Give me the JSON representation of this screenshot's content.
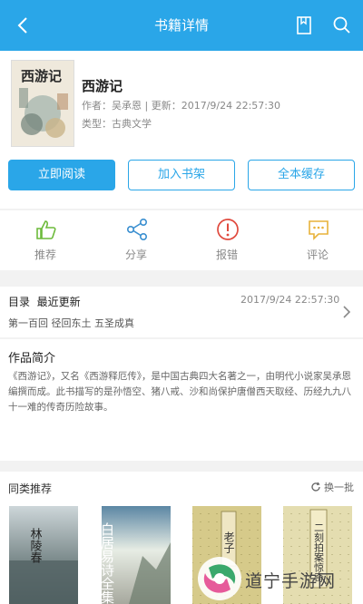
{
  "header": {
    "title": "书籍详情"
  },
  "book": {
    "title": "西游记",
    "author_label": "作者：",
    "author": "吴承恩",
    "update_label": "更新：",
    "update_time": "2017/9/24 22:57:30",
    "type_label": "类型：",
    "type": "古典文学",
    "cover_text": "西游记"
  },
  "buttons": {
    "read": "立即阅读",
    "add_shelf": "加入书架",
    "cache_all": "全本缓存"
  },
  "actions": [
    {
      "label": "推荐",
      "icon": "thumbs-up-icon",
      "color": "#6cba3a"
    },
    {
      "label": "分享",
      "icon": "share-icon",
      "color": "#3a8fd0"
    },
    {
      "label": "报错",
      "icon": "error-icon",
      "color": "#e04a3e"
    },
    {
      "label": "评论",
      "icon": "comment-icon",
      "color": "#e8b23a"
    }
  ],
  "catalog": {
    "label": "目录",
    "latest_label": "最近更新",
    "time": "2017/9/24 22:57:30",
    "latest_chapter": "第一百回 径回东土 五圣成真"
  },
  "intro": {
    "heading": "作品简介",
    "text": "《西游记》，又名《西游释厄传》，是中国古典四大名著之一，由明代小说家吴承恩编撰而成。此书描写的是孙悟空、猪八戒、沙和尚保护唐僧西天取经、历经九九八十一难的传奇历险故事。"
  },
  "similar": {
    "heading": "同类推荐",
    "refresh": "换一批",
    "books": [
      {
        "title": "林陵春"
      },
      {
        "title": "白居易诗全集"
      },
      {
        "title": "老子"
      },
      {
        "title": "二刻拍案惊奇"
      }
    ]
  },
  "watermark": {
    "text": "道宁手游网"
  },
  "colors": {
    "accent": "#2aa6e8"
  }
}
